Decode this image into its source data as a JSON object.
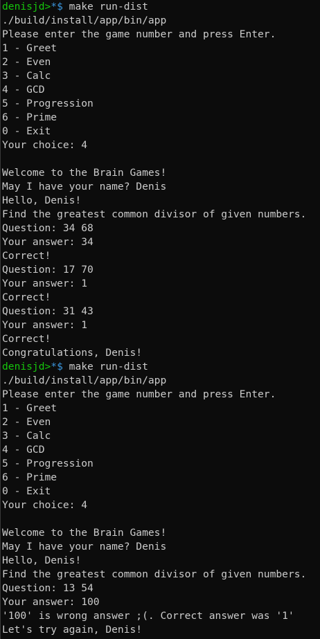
{
  "terminal": {
    "colors": {
      "background": "#0c0c0c",
      "text": "#cccccc",
      "prompt_user": "#16c60c",
      "prompt_dir": "#3a96dd"
    },
    "lines": [
      {
        "type": "prompt",
        "user": "denisjd>",
        "dir": "*$",
        "cmd": " make run-dist"
      },
      {
        "type": "text",
        "text": "./build/install/app/bin/app"
      },
      {
        "type": "text",
        "text": "Please enter the game number and press Enter."
      },
      {
        "type": "text",
        "text": "1 - Greet"
      },
      {
        "type": "text",
        "text": "2 - Even"
      },
      {
        "type": "text",
        "text": "3 - Calc"
      },
      {
        "type": "text",
        "text": "4 - GCD"
      },
      {
        "type": "text",
        "text": "5 - Progression"
      },
      {
        "type": "text",
        "text": "6 - Prime"
      },
      {
        "type": "text",
        "text": "0 - Exit"
      },
      {
        "type": "text",
        "text": "Your choice: 4"
      },
      {
        "type": "text",
        "text": ""
      },
      {
        "type": "text",
        "text": "Welcome to the Brain Games!"
      },
      {
        "type": "text",
        "text": "May I have your name? Denis"
      },
      {
        "type": "text",
        "text": "Hello, Denis!"
      },
      {
        "type": "text",
        "text": "Find the greatest common divisor of given numbers."
      },
      {
        "type": "text",
        "text": "Question: 34 68"
      },
      {
        "type": "text",
        "text": "Your answer: 34"
      },
      {
        "type": "text",
        "text": "Correct!"
      },
      {
        "type": "text",
        "text": "Question: 17 70"
      },
      {
        "type": "text",
        "text": "Your answer: 1"
      },
      {
        "type": "text",
        "text": "Correct!"
      },
      {
        "type": "text",
        "text": "Question: 31 43"
      },
      {
        "type": "text",
        "text": "Your answer: 1"
      },
      {
        "type": "text",
        "text": "Correct!"
      },
      {
        "type": "text",
        "text": "Congratulations, Denis!"
      },
      {
        "type": "prompt",
        "user": "denisjd>",
        "dir": "*$",
        "cmd": " make run-dist"
      },
      {
        "type": "text",
        "text": "./build/install/app/bin/app"
      },
      {
        "type": "text",
        "text": "Please enter the game number and press Enter."
      },
      {
        "type": "text",
        "text": "1 - Greet"
      },
      {
        "type": "text",
        "text": "2 - Even"
      },
      {
        "type": "text",
        "text": "3 - Calc"
      },
      {
        "type": "text",
        "text": "4 - GCD"
      },
      {
        "type": "text",
        "text": "5 - Progression"
      },
      {
        "type": "text",
        "text": "6 - Prime"
      },
      {
        "type": "text",
        "text": "0 - Exit"
      },
      {
        "type": "text",
        "text": "Your choice: 4"
      },
      {
        "type": "text",
        "text": ""
      },
      {
        "type": "text",
        "text": "Welcome to the Brain Games!"
      },
      {
        "type": "text",
        "text": "May I have your name? Denis"
      },
      {
        "type": "text",
        "text": "Hello, Denis!"
      },
      {
        "type": "text",
        "text": "Find the greatest common divisor of given numbers."
      },
      {
        "type": "text",
        "text": "Question: 13 54"
      },
      {
        "type": "text",
        "text": "Your answer: 100"
      },
      {
        "type": "text",
        "text": "'100' is wrong answer ;(. Correct answer was '1'"
      },
      {
        "type": "text",
        "text": "Let's try again, Denis!"
      }
    ]
  }
}
